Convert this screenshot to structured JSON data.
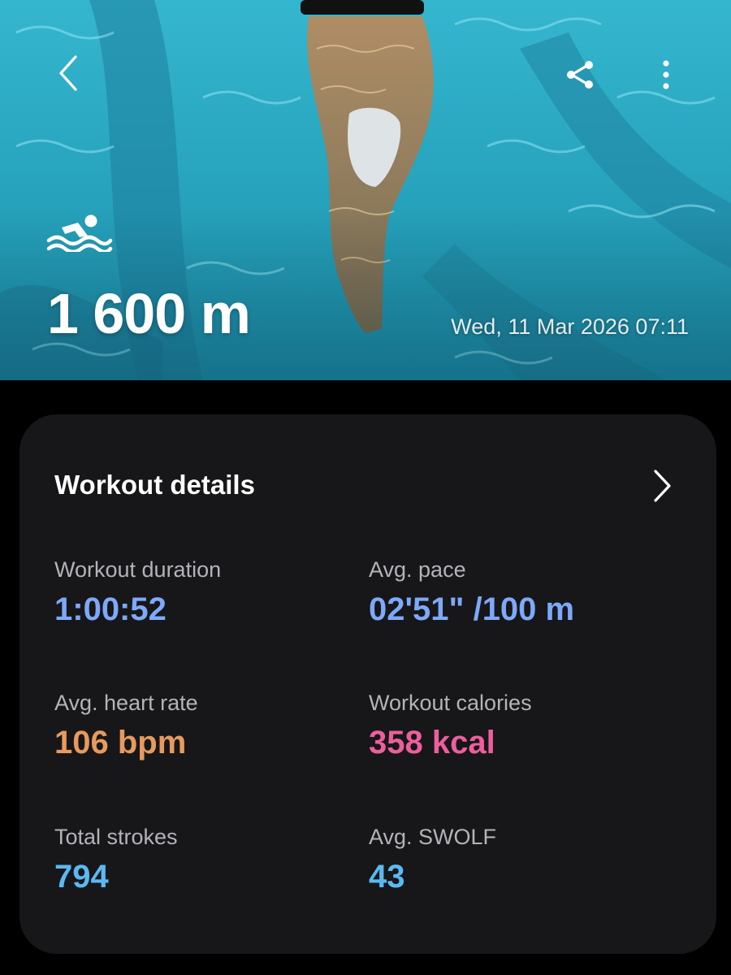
{
  "hero": {
    "distance": "1 600 m",
    "datetime": "Wed, 11 Mar 2026 07:11",
    "activity_icon": "swimming-icon",
    "back_icon": "chevron-left-icon",
    "share_icon": "share-icon",
    "more_icon": "more-vertical-icon"
  },
  "details": {
    "title": "Workout details",
    "chevron_icon": "chevron-right-icon",
    "stats": [
      {
        "label": "Workout duration",
        "value": "1:00:52",
        "color": "#7ea8f8"
      },
      {
        "label": "Avg. pace",
        "value": "02'51\" /100 m",
        "color": "#7ea8f8"
      },
      {
        "label": "Avg. heart rate",
        "value": "106 bpm",
        "color": "#e69a5e"
      },
      {
        "label": "Workout calories",
        "value": "358 kcal",
        "color": "#ec5f9c"
      },
      {
        "label": "Total strokes",
        "value": "794",
        "color": "#5bb8f0"
      },
      {
        "label": "Avg. SWOLF",
        "value": "43",
        "color": "#5bb8f0"
      }
    ]
  },
  "colors": {
    "background": "#000000",
    "card": "#17171a",
    "label": "#b3b3b8",
    "pool_water": "#2aa9c4"
  }
}
